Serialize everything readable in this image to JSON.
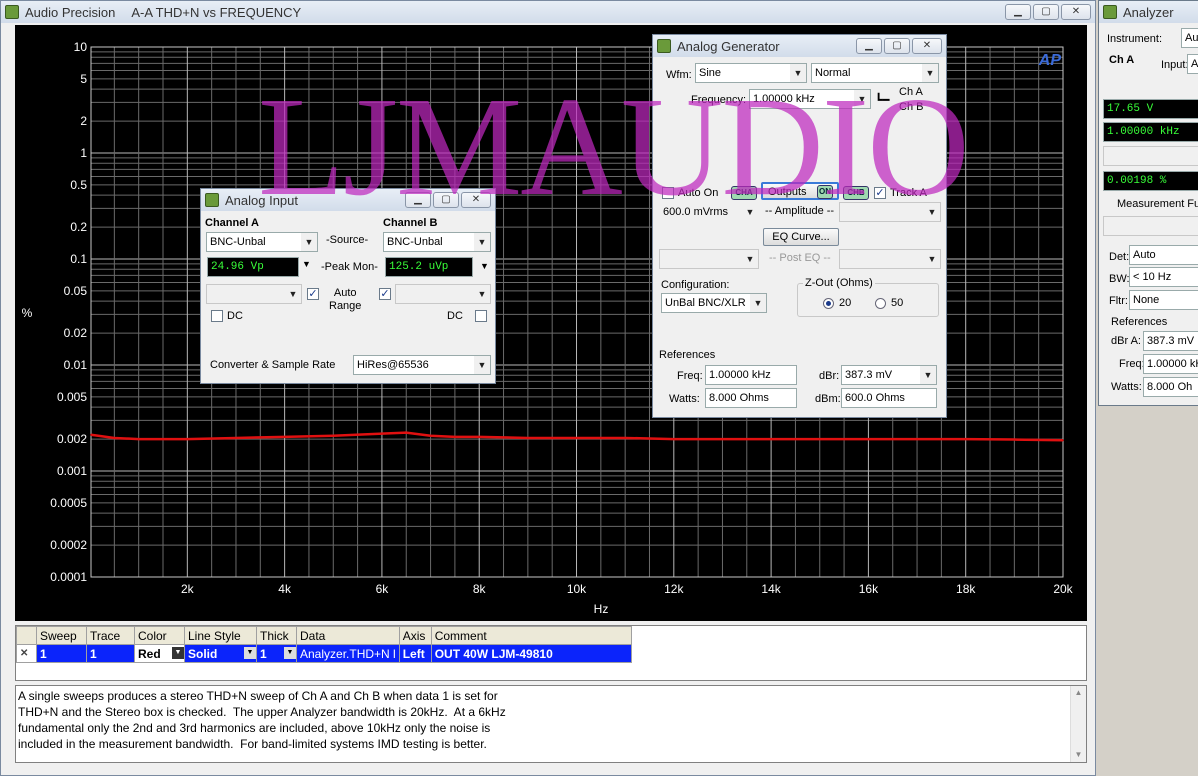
{
  "main_window": {
    "app": "Audio Precision",
    "graph_title": "A-A THD+N vs FREQUENCY"
  },
  "graph": {
    "ylabel": "%",
    "xlabel": "Hz",
    "y_tick_labels": [
      "10",
      "5",
      "2",
      "1",
      "0.5",
      "0.2",
      "0.1",
      "0.05",
      "0.02",
      "0.01",
      "0.005",
      "0.002",
      "0.001",
      "0.0005",
      "0.0002",
      "0.0001"
    ],
    "x_tick_labels": [
      "2k",
      "4k",
      "6k",
      "8k",
      "10k",
      "12k",
      "14k",
      "16k",
      "18k",
      "20k"
    ],
    "logo": "AP",
    "trace_color": "#e01010"
  },
  "chart_data": {
    "type": "line",
    "xlabel": "Hz",
    "ylabel": "%",
    "ylog": true,
    "xlim": [
      20,
      20000
    ],
    "ylim": [
      0.0001,
      10
    ],
    "grid": true,
    "series": [
      {
        "x": [
          20,
          500,
          1000,
          2000,
          3000,
          4000,
          5000,
          6000,
          6500,
          7000,
          7500,
          8000,
          9000,
          10000,
          11000,
          12000,
          13000,
          14000,
          15000,
          16000,
          17000,
          18000,
          19000,
          20000
        ],
        "values": [
          0.0022,
          0.00205,
          0.002,
          0.002,
          0.00205,
          0.0021,
          0.00215,
          0.00225,
          0.0023,
          0.00215,
          0.0021,
          0.0021,
          0.00205,
          0.00205,
          0.00205,
          0.002,
          0.002,
          0.002,
          0.002,
          0.002,
          0.002,
          0.002,
          0.00198,
          0.00195
        ]
      }
    ]
  },
  "watermark": "LJMAUDIO",
  "sweep_table": {
    "headers": [
      "Sweep",
      "Trace",
      "Color",
      "Line Style",
      "Thick",
      "Data",
      "Axis",
      "Comment"
    ],
    "row": {
      "check": "✕",
      "sweep": "1",
      "trace": "1",
      "color": "Red",
      "line_style": "Solid",
      "thick": "1",
      "data": "Analyzer.THD+N l",
      "axis": "Left",
      "comment": "OUT 40W LJM-49810"
    }
  },
  "notes": "A single sweeps produces a stereo THD+N sweep of Ch A and Ch B when data 1 is set for\nTHD+N and the Stereo box is checked.  The upper Analyzer bandwidth is 20kHz.  At a 6kHz\nfundamental only the 2nd and 3rd harmonics are included, above 10kHz only the noise is\nincluded in the measurement bandwidth.  For band-limited systems IMD testing is better.",
  "analog_input": {
    "title": "Analog Input",
    "channel_a": "Channel A",
    "channel_b": "Channel B",
    "source_label": "-Source-",
    "source_a": "BNC-Unbal",
    "source_b": "BNC-Unbal",
    "peak_mon_label": "-Peak Mon-",
    "peak_a": "24.96   Vp",
    "peak_b": "125.2   uVp",
    "auto_range": "Auto\nRange",
    "dc": "DC",
    "converter_label": "Converter & Sample Rate",
    "converter_value": "HiRes@65536"
  },
  "analog_generator": {
    "title": "Analog Generator",
    "wfm_label": "Wfm:",
    "wfm": "Sine",
    "wfm_mode": "Normal",
    "frequency_label": "Frequency:",
    "frequency": "1.00000 kHz",
    "ch_a": "Ch A",
    "ch_b": "Ch B",
    "auto_on": "Auto On",
    "cha_tag": "CHA",
    "outputs": "Outputs",
    "on_tag": "ON",
    "chb_tag": "CHB",
    "track_a": "Track A",
    "amplitude_value": "600.0   mVrms",
    "amplitude_label": "-- Amplitude --",
    "eq_curve": "EQ Curve...",
    "post_eq": "-- Post EQ --",
    "configuration_label": "Configuration:",
    "configuration": "UnBal BNC/XLR",
    "zout_label": "Z-Out (Ohms)",
    "zout_20": "20",
    "zout_50": "50",
    "references_label": "References",
    "freq_label": "Freq:",
    "freq_ref": "1.00000 kHz",
    "dbr_label": "dBr:",
    "dbr_ref": "387.3   mV",
    "watts_label": "Watts:",
    "watts_ref": "8.000    Ohms",
    "dbm_label": "dBm:",
    "dbm_ref": "600.0    Ohms"
  },
  "analyzer": {
    "title": "Analyzer",
    "instrument_label": "Instrument:",
    "instrument": "Au",
    "ch_a": "Ch A",
    "input_label": "Input:",
    "input": "A",
    "reading_1": "17.65   V",
    "reading_2": "1.00000 kHz",
    "reading_3": "0.00198  %",
    "measurement_label": "Measurement Fur",
    "det_label": "Det:",
    "det": "Auto",
    "bw_label": "BW:",
    "bw": "< 10 Hz",
    "fltr_label": "Fltr:",
    "fltr": "None",
    "references_label": "References",
    "dbra_label": "dBr A:",
    "dbra": "387.3   mV",
    "freq_label": "Freq:",
    "freq": "1.00000 kH",
    "watts_label": "Watts:",
    "watts": "8.000    Oh"
  }
}
